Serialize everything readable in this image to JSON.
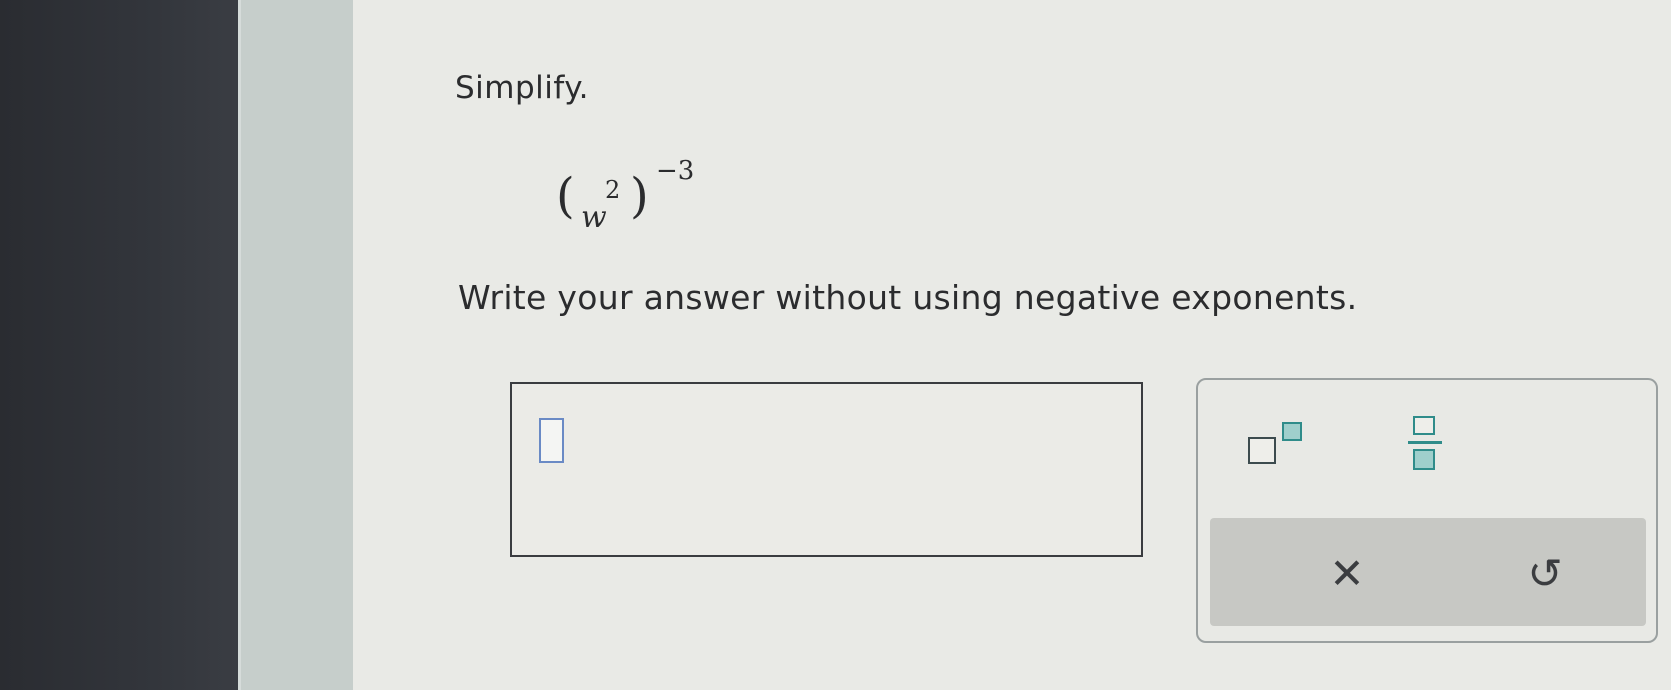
{
  "question": {
    "prompt": "Simplify.",
    "expression": {
      "base": "w",
      "inner_exponent": "2",
      "outer_exponent": "−3",
      "open_paren": "(",
      "close_paren": ")"
    },
    "instruction": "Write your answer without using negative exponents."
  },
  "answer": {
    "value": ""
  },
  "toolbar": {
    "tools": [
      {
        "name": "exponent",
        "icon": "exponent-template-icon"
      },
      {
        "name": "fraction",
        "icon": "fraction-template-icon"
      }
    ],
    "actions": [
      {
        "name": "clear",
        "glyph": "✕",
        "icon": "clear-icon"
      },
      {
        "name": "undo",
        "glyph": "↺",
        "icon": "undo-icon"
      }
    ]
  }
}
